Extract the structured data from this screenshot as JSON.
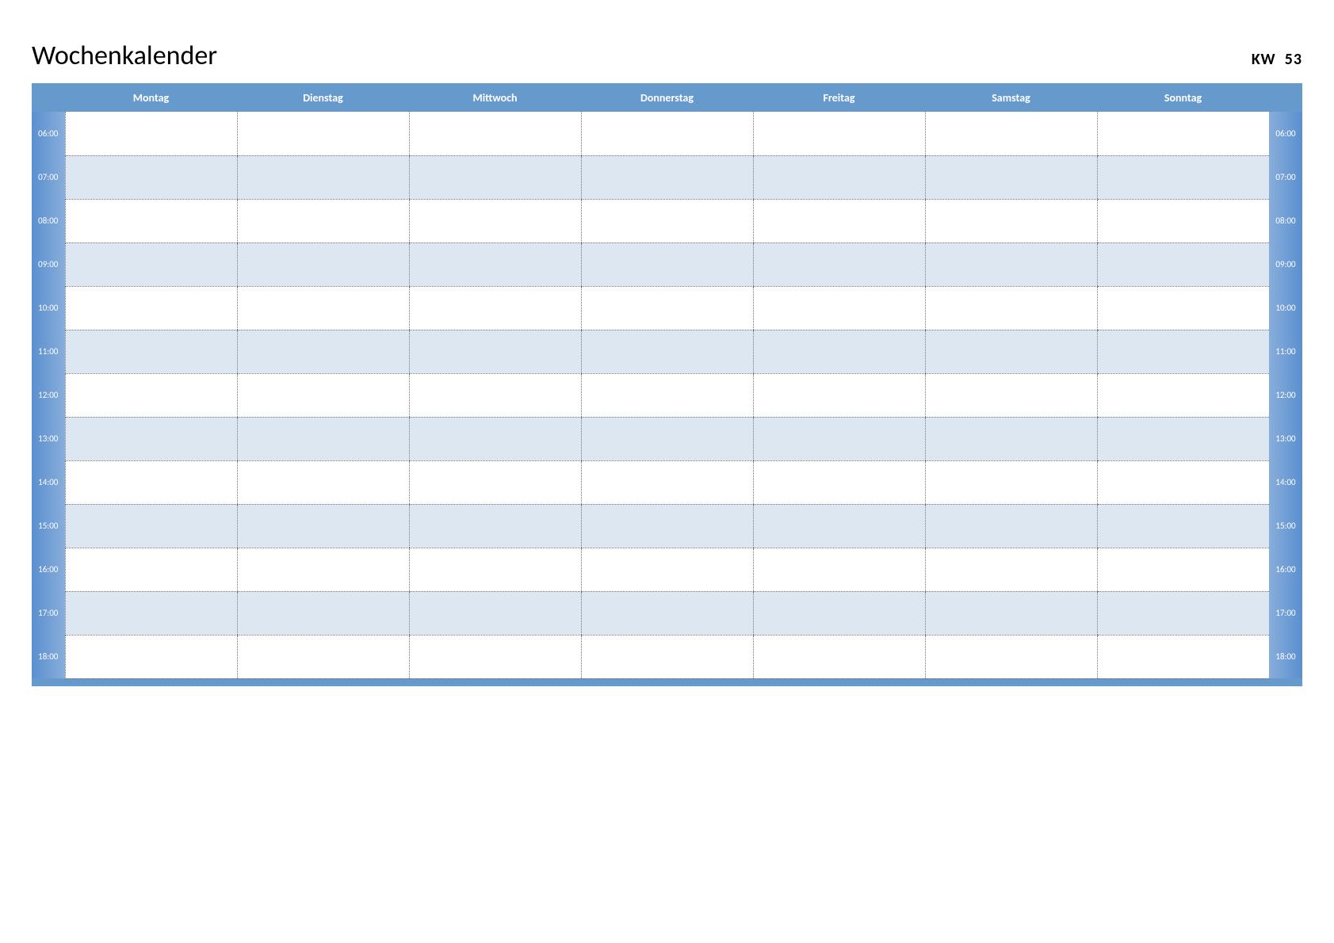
{
  "header": {
    "title": "Wochenkalender",
    "kw_label": "KW",
    "kw_number": "53"
  },
  "days": [
    "Montag",
    "Dienstag",
    "Mittwoch",
    "Donnerstag",
    "Freitag",
    "Samstag",
    "Sonntag"
  ],
  "hours": [
    "06:00",
    "07:00",
    "08:00",
    "09:00",
    "10:00",
    "11:00",
    "12:00",
    "13:00",
    "14:00",
    "15:00",
    "16:00",
    "17:00",
    "18:00"
  ]
}
